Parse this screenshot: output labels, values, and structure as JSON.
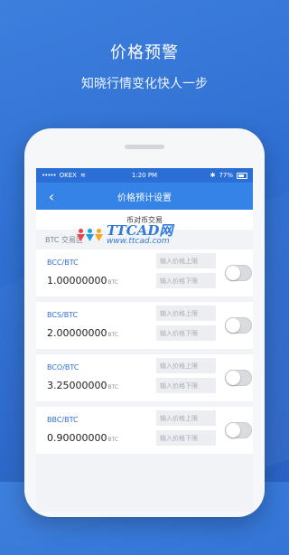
{
  "hero": {
    "title": "价格预警",
    "subtitle": "知晓行情变化快人一步"
  },
  "status_bar": {
    "carrier": "OKEX",
    "signal": "•••••",
    "time": "1:20 PM",
    "battery": "77%"
  },
  "nav": {
    "back_icon": "‹",
    "title": "价格预计设置"
  },
  "market_tab": "币对币交易",
  "section_title": "BTC 交易区",
  "watermark": {
    "brand": "TTCAD网",
    "url": "www.ttcad.com"
  },
  "placeholders": {
    "upper": "输入价格上限",
    "lower": "输入价格下限"
  },
  "pairs": [
    {
      "name": "BCC/BTC",
      "price": "1.00000000",
      "unit": "BTC",
      "alert_enabled": false
    },
    {
      "name": "BCS/BTC",
      "price": "2.00000000",
      "unit": "BTC",
      "alert_enabled": false
    },
    {
      "name": "BCO/BTC",
      "price": "3.25000000",
      "unit": "BTC",
      "alert_enabled": false
    },
    {
      "name": "BBC/BTC",
      "price": "0.90000000",
      "unit": "BTC",
      "alert_enabled": false
    }
  ]
}
